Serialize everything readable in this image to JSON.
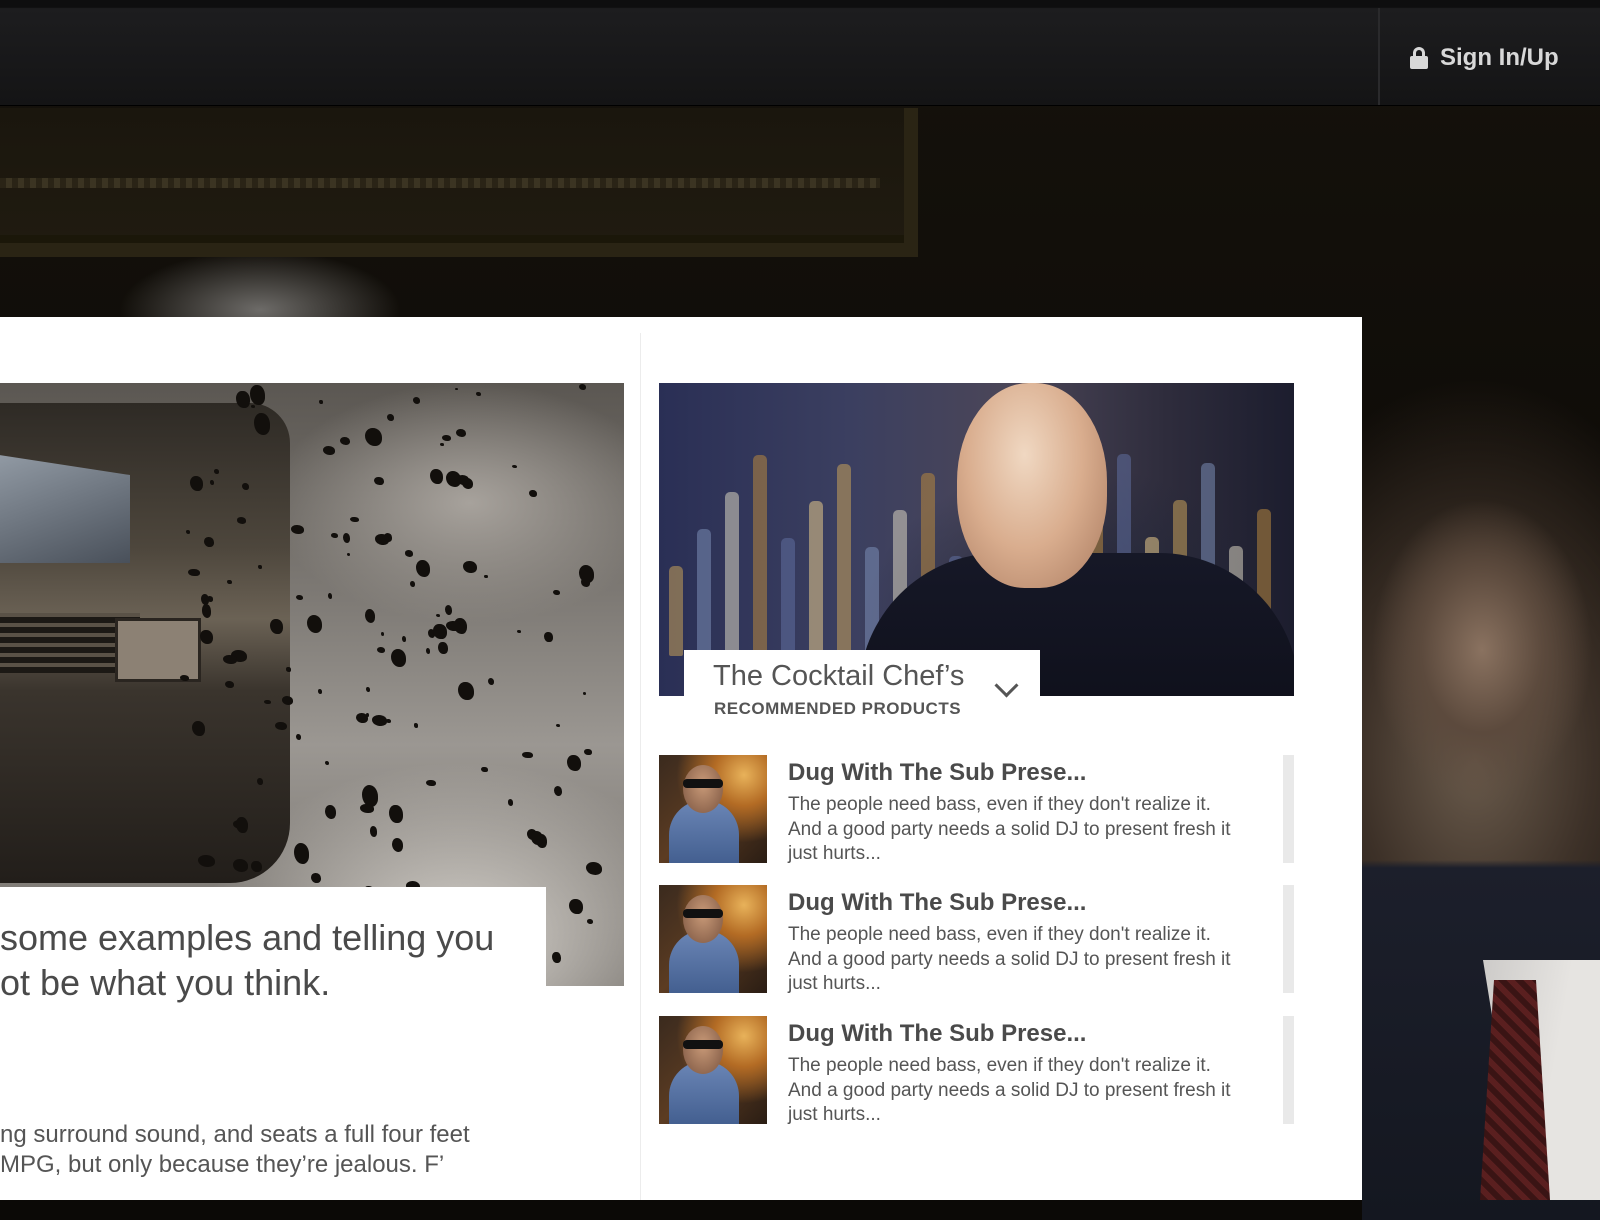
{
  "header": {
    "signin_label": "Sign In/Up"
  },
  "article": {
    "headline": "some examples and telling you\not be what you think.",
    "body": "ng surround sound, and seats a full four feet\n MPG, but only because they’re jealous. F’"
  },
  "sidebar": {
    "chef_title": "The Cocktail Chef’s",
    "chef_subtitle": "RECOMMENDED PRODUCTS",
    "products": [
      {
        "title": "Dug With The Sub Prese...",
        "description": "The people need bass, even if they don't realize it. And a good party needs a solid DJ to present fresh it just hurts..."
      },
      {
        "title": "Dug With The Sub Prese...",
        "description": "The people need bass, even if they don't realize it. And a good party needs a solid DJ to present fresh it just hurts..."
      },
      {
        "title": "Dug With The Sub Prese...",
        "description": "The people need bass, even if they don't realize it. And a good party needs a solid DJ to present fresh it just hurts..."
      }
    ]
  },
  "icons": {
    "signin": "lock-icon",
    "dropdown": "chevron-down-icon"
  },
  "colors": {
    "topbar": "#1d1d1f",
    "panel": "#ffffff",
    "text_dark": "#4a4a4a"
  }
}
